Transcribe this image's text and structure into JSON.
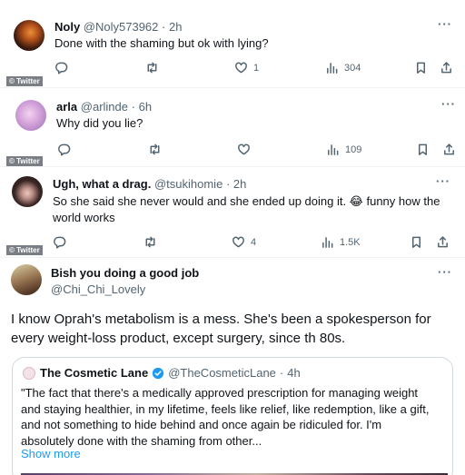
{
  "tweets": [
    {
      "display_name": "Noly",
      "handle": "@Noly573962",
      "time": "2h",
      "text": "Done with the shaming but ok with lying?",
      "replies": "",
      "retweets": "",
      "likes": "1",
      "views": "304",
      "watermark": "© Twitter"
    },
    {
      "display_name": "arla",
      "handle": "@arlinde",
      "time": "6h",
      "text": "Why did you lie?",
      "replies": "",
      "retweets": "",
      "likes": "",
      "views": "109",
      "watermark": "© Twitter"
    },
    {
      "display_name": "Ugh, what a drag.",
      "handle": "@tsukihomie",
      "time": "2h",
      "text_line1": "So she said she never would and she ended up doing it. 😂 funny how the",
      "text_line2": "world works",
      "replies": "",
      "retweets": "",
      "likes": "4",
      "views": "1.5K",
      "watermark": "© Twitter"
    },
    {
      "display_name": "Bish you doing a good job",
      "handle": "@Chi_Chi_Lovely",
      "text_line1": "I know Oprah's metabolism is a mess. She's been a spokesperson for",
      "text_line2": "every weight-loss product, except surgery, since th 80s."
    }
  ],
  "quote": {
    "display_name": "The Cosmetic Lane",
    "handle": "@TheCosmeticLane",
    "time": "4h",
    "text_line1": "\"The fact that there's a medically approved prescription for managing weight",
    "text_line2": "and staying healthier, in my lifetime, feels like relief, like redemption, like a gift,",
    "text_line3": "and not something to hide behind and once again be ridiculed for. I'm",
    "text_line4": "absolutely done with the shaming from other...",
    "show_more": "Show more",
    "verified_color": "#1d9bf0"
  },
  "separator": "·",
  "more_glyph": "···",
  "icons": [
    "reply-icon",
    "retweet-icon",
    "like-icon",
    "views-icon",
    "bookmark-icon",
    "share-icon",
    "more-icon",
    "verified-icon"
  ]
}
